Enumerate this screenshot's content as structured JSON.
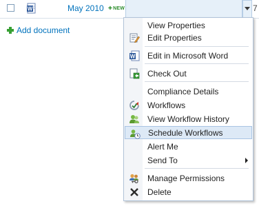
{
  "row": {
    "document_name": "May 2010",
    "new_badge": "NEW",
    "edge_char": "7"
  },
  "add_document": "Add document",
  "menu": {
    "items": [
      {
        "label": "View Properties",
        "icon": "none"
      },
      {
        "label": "Edit Properties",
        "icon": "edit-properties-icon"
      },
      {
        "label": "Edit in Microsoft Word",
        "icon": "word-icon"
      },
      {
        "label": "Check Out",
        "icon": "check-out-icon"
      },
      {
        "label": "Compliance Details",
        "icon": "none"
      },
      {
        "label": "Workflows",
        "icon": "workflows-icon"
      },
      {
        "label": "View Workflow History",
        "icon": "workflow-history-icon"
      },
      {
        "label": "Schedule Workflows",
        "icon": "schedule-workflows-icon",
        "highlighted": true
      },
      {
        "label": "Alert Me",
        "icon": "none"
      },
      {
        "label": "Send To",
        "icon": "none",
        "submenu": true
      },
      {
        "label": "Manage Permissions",
        "icon": "manage-permissions-icon"
      },
      {
        "label": "Delete",
        "icon": "delete-icon"
      }
    ]
  },
  "colors": {
    "link": "#0072bc",
    "accent_green": "#37a033",
    "highlight_bg": "#dde9f6",
    "row_hover_bg": "#e6f0f9"
  }
}
